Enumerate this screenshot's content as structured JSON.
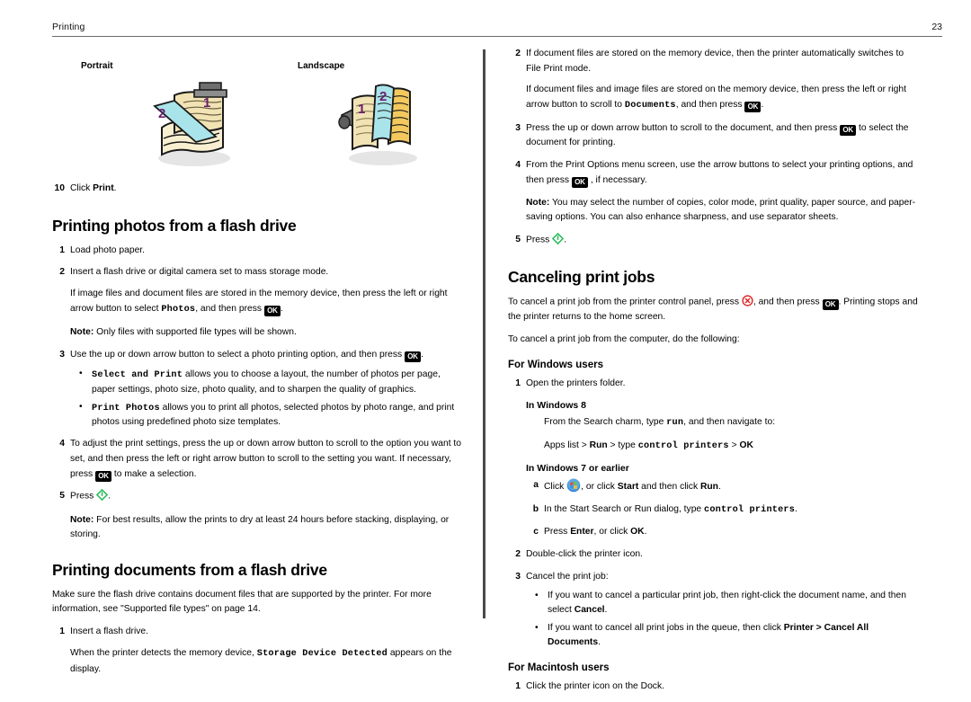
{
  "header": {
    "chapter": "Printing",
    "page_number": "23"
  },
  "figure": {
    "portrait_label": "Portrait",
    "landscape_label": "Landscape",
    "portrait_marks": [
      "1",
      "2"
    ],
    "landscape_marks": [
      "1",
      "2"
    ],
    "colors": {
      "paper": "#f1e3b4",
      "arrow": "#a9e4ea",
      "mark": "#6a1f6e",
      "clip": "#5d5d5d",
      "outline": "#1a1a1a"
    }
  },
  "icons": {
    "ok_label": "OK",
    "start_color": "#22bb55",
    "cancel_color": "#e02020",
    "windows_orb_color": "#2f7fd0"
  },
  "left_column": {
    "step10": {
      "marker": "10",
      "text_before": "Click ",
      "bold": "Print",
      "text_after": "."
    },
    "photos_section": {
      "heading": "Printing photos from a flash drive",
      "steps": [
        {
          "marker": "1",
          "text": "Load photo paper."
        },
        {
          "marker": "2",
          "text": "Insert a flash drive or digital camera set to mass storage mode.",
          "cont_a": "If image files and document files are stored in the memory device, then press the left or right arrow button to select ",
          "cont_mono": "Photos",
          "cont_b": ", and then press ",
          "cont_c": ".",
          "note_label": "Note:",
          "note_text": " Only files with supported file types will be shown."
        },
        {
          "marker": "3",
          "text_a": "Use the up or down arrow button to select a photo printing option, and then press ",
          "text_b": ".",
          "bullets": [
            {
              "mono": "Select and Print",
              "text": " allows you to choose a layout, the number of photos per page, paper settings, photo size, photo quality, and to sharpen the quality of graphics."
            },
            {
              "mono": "Print Photos",
              "text": " allows you to print all photos, selected photos by photo range, and print photos using predefined photo size templates."
            }
          ]
        },
        {
          "marker": "4",
          "text_a": "To adjust the print settings, press the up or down arrow button to scroll to the option you want to set, and then press the left or right arrow button to scroll to the setting you want. If necessary, press ",
          "text_b": " to make a selection."
        },
        {
          "marker": "5",
          "text_a": "Press ",
          "text_b": ".",
          "note_label": "Note:",
          "note_text": " For best results, allow the prints to dry at least 24 hours before stacking, displaying, or storing."
        }
      ]
    },
    "documents_section": {
      "heading": "Printing documents from a flash drive",
      "intro": "Make sure the flash drive contains document files that are supported by the printer. For more information, see \"Supported file types\" on page 14.",
      "steps": [
        {
          "marker": "1",
          "text": "Insert a flash drive.",
          "cont_a": "When the printer detects the memory device, ",
          "cont_mono": "Storage Device Detected",
          "cont_b": " appears on the display."
        }
      ]
    }
  },
  "right_column": {
    "documents_steps": [
      {
        "marker": "2",
        "text": "If document files are stored on the memory device, then the printer automatically switches to File Print mode.",
        "cont_a": "If document files and image files are stored on the memory device, then press the left or right arrow button to scroll to ",
        "cont_mono": "Documents",
        "cont_b": ", and then press ",
        "cont_c": "."
      },
      {
        "marker": "3",
        "text_a": "Press the up or down arrow button to scroll to the document, and then press ",
        "text_b": " to select the document for printing."
      },
      {
        "marker": "4",
        "text_a": "From the Print Options menu screen, use the arrow buttons to select your printing options, and then press ",
        "text_b": " , if necessary.",
        "note_label": "Note:",
        "note_text": " You may select the number of copies, color mode, print quality, paper source, and paper-saving options. You can also enhance sharpness, and use separator sheets."
      },
      {
        "marker": "5",
        "text_a": "Press ",
        "text_b": "."
      }
    ],
    "cancel_section": {
      "heading": "Canceling print jobs",
      "para1_a": "To cancel a print job from the printer control panel, press ",
      "para1_b": ", and then press ",
      "para1_c": ". Printing stops and the printer returns to the home screen.",
      "para2": "To cancel a print job from the computer, do the following:",
      "windows": {
        "heading": "For Windows users",
        "step1": {
          "marker": "1",
          "text": "Open the printers folder."
        },
        "win8": {
          "heading": "In Windows 8",
          "line1_a": "From the Search charm, type ",
          "line1_mono": "run",
          "line1_b": ", and then navigate to:",
          "line2_a": "Apps list > ",
          "line2_bold1": "Run",
          "line2_b": " > type ",
          "line2_mono": "control printers",
          "line2_c": " > ",
          "line2_bold2": "OK"
        },
        "win7": {
          "heading": "In Windows 7 or earlier",
          "steps": [
            {
              "marker": "a",
              "text_a": "Click ",
              "text_b": ", or click ",
              "bold1": "Start",
              "text_c": " and then click ",
              "bold2": "Run",
              "text_d": "."
            },
            {
              "marker": "b",
              "text_a": "In the Start Search or Run dialog, type ",
              "mono": "control printers",
              "text_b": "."
            },
            {
              "marker": "c",
              "text_a": "Press ",
              "bold1": "Enter",
              "text_b": ", or click ",
              "bold2": "OK",
              "text_c": "."
            }
          ]
        },
        "step2": {
          "marker": "2",
          "text": "Double-click the printer icon."
        },
        "step3": {
          "marker": "3",
          "text": "Cancel the print job:",
          "bullets": [
            {
              "text_a": "If you want to cancel a particular print job, then right-click the document name, and then select ",
              "bold": "Cancel",
              "text_b": "."
            },
            {
              "text_a": "If you want to cancel all print jobs in the queue, then click ",
              "bold": "Printer > Cancel All Documents",
              "text_b": "."
            }
          ]
        }
      },
      "macintosh": {
        "heading": "For Macintosh users",
        "step1": {
          "marker": "1",
          "text": "Click the printer icon on the Dock."
        }
      }
    }
  }
}
